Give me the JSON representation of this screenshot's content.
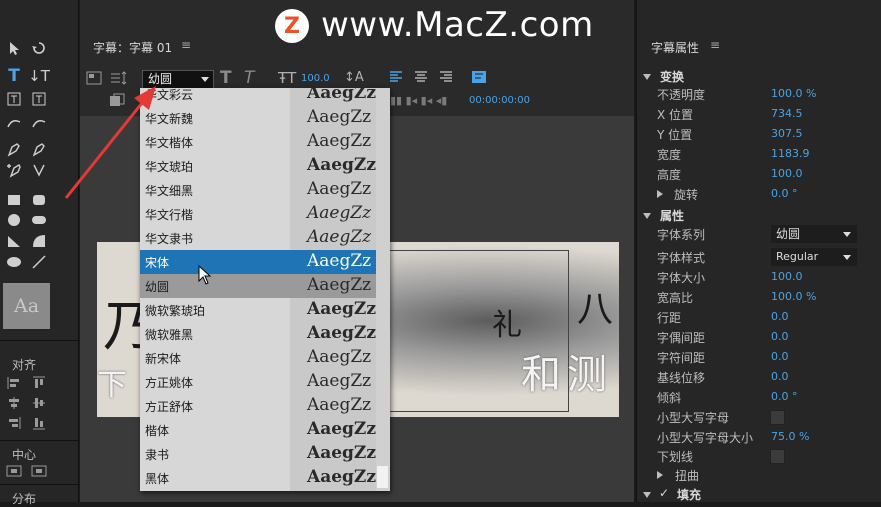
{
  "watermark": {
    "logo_letter": "Z",
    "text": "www.MacZ.com"
  },
  "center": {
    "title": "字幕：字幕 01",
    "menu_glyph": "≡",
    "font_family_value": "幼圆",
    "font_size_value": "100.0",
    "timecode": "00:00:00:00"
  },
  "font_list": [
    {
      "name": "华文彩云",
      "preview": "AaegZz",
      "state": "partial"
    },
    {
      "name": "华文新魏",
      "preview": "AaegZz",
      "state": "normal"
    },
    {
      "name": "华文楷体",
      "preview": "AaegZz",
      "state": "normal"
    },
    {
      "name": "华文琥珀",
      "preview": "AaegZz",
      "state": "normal"
    },
    {
      "name": "华文细黑",
      "preview": "AaegZz",
      "state": "normal"
    },
    {
      "name": "华文行楷",
      "preview": "AaegZz",
      "state": "normal"
    },
    {
      "name": "华文隶书",
      "preview": "AaegZz",
      "state": "normal"
    },
    {
      "name": "宋体",
      "preview": "AaegZz",
      "state": "selected"
    },
    {
      "name": "幼圆",
      "preview": "AaegZz",
      "state": "hover"
    },
    {
      "name": "微软繁琥珀",
      "preview": "AaegZz",
      "state": "normal"
    },
    {
      "name": "微软雅黑",
      "preview": "AaegZz",
      "state": "normal"
    },
    {
      "name": "新宋体",
      "preview": "AaegZz",
      "state": "normal"
    },
    {
      "name": "方正姚体",
      "preview": "AaegZz",
      "state": "normal"
    },
    {
      "name": "方正舒体",
      "preview": "AaegZz",
      "state": "normal"
    },
    {
      "name": "楷体",
      "preview": "AaegZz",
      "state": "normal"
    },
    {
      "name": "隶书",
      "preview": "AaegZz",
      "state": "normal"
    },
    {
      "name": "黑体",
      "preview": "AaegZz",
      "state": "normal"
    }
  ],
  "tools_panel": {
    "swatch_label": "Aa",
    "align_label": "对齐",
    "center_label": "中心",
    "distribute_label": "分布"
  },
  "artwork": {
    "ink_chars": [
      "礼",
      "八",
      "乃",
      "丨"
    ],
    "overlay_text": "和测",
    "overlay_left": "下"
  },
  "properties": {
    "title": "字幕属性",
    "menu_glyph": "≡",
    "transform_group": "变换",
    "opacity_label": "不透明度",
    "opacity_value": "100.0 %",
    "x_label": "X 位置",
    "x_value": "734.5",
    "y_label": "Y 位置",
    "y_value": "307.5",
    "width_label": "宽度",
    "width_value": "1183.9",
    "height_label": "高度",
    "height_value": "100.0",
    "rotate_label": "旋转",
    "rotate_value": "0.0 °",
    "props_group": "属性",
    "font_family_label": "字体系列",
    "font_family_value": "幼圆",
    "font_style_label": "字体样式",
    "font_style_value": "Regular",
    "font_size_label": "字体大小",
    "font_size_value": "100.0",
    "aspect_label": "宽高比",
    "aspect_value": "100.0 %",
    "leading_label": "行距",
    "leading_value": "0.0",
    "kerning_label": "字偶间距",
    "kerning_value": "0.0",
    "tracking_label": "字符间距",
    "tracking_value": "0.0",
    "baseline_label": "基线位移",
    "baseline_value": "0.0",
    "slant_label": "倾斜",
    "slant_value": "0.0 °",
    "smallcaps_label": "小型大写字母",
    "smallcaps_size_label": "小型大写字母大小",
    "smallcaps_size_value": "75.0 %",
    "underline_label": "下划线",
    "distort_label": "扭曲",
    "fill_check": "✓",
    "fill_label": "填充"
  },
  "colors": {
    "accent": "#4aa3e6",
    "selected": "#1e74b5",
    "arrow": "#e53935"
  }
}
